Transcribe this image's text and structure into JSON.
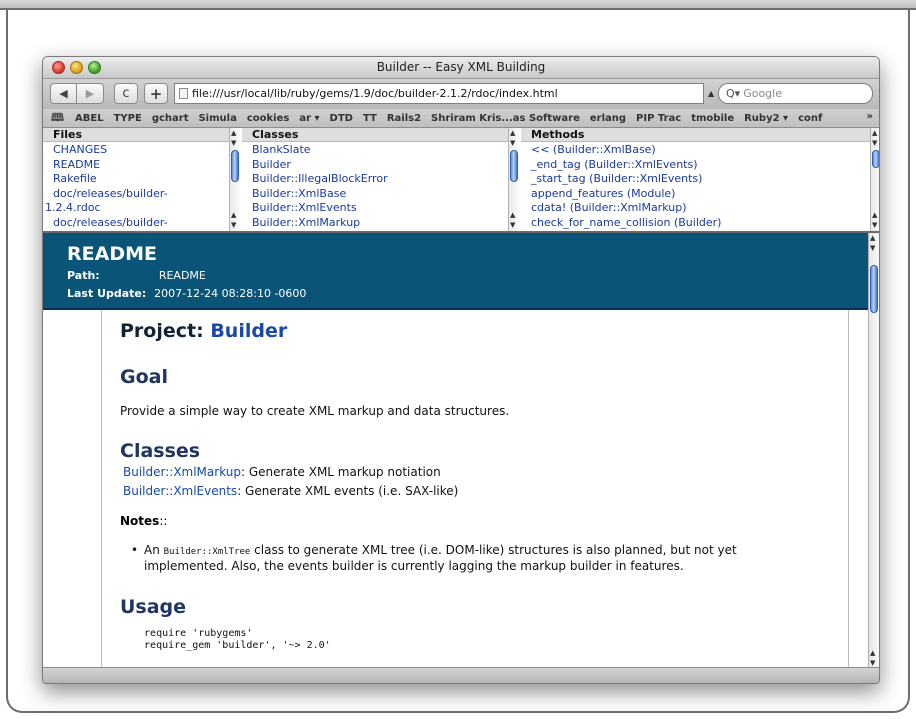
{
  "window": {
    "title": "Builder -- Easy XML Building"
  },
  "toolbar": {
    "back_icon": "◀",
    "forward_icon": "▶",
    "reload_icon": "c",
    "add_icon": "+",
    "url": "file:///usr/local/lib/ruby/gems/1.9/doc/builder-2.1.2/rdoc/index.html",
    "search_placeholder": "Google",
    "search_icon": "Q▾"
  },
  "bookmarks": {
    "book_icon": "🕮",
    "items": [
      "ABEL",
      "TYPE",
      "gchart",
      "Simula",
      "cookies",
      "ar ▾",
      "DTD",
      "TT",
      "Rails2",
      "Shriram Kris...as Software",
      "erlang",
      "PIP Trac",
      "tmobile",
      "Ruby2 ▾",
      "conf"
    ],
    "more": "»"
  },
  "frames": {
    "files": {
      "header": "Files",
      "items": [
        "CHANGES",
        "README",
        "Rakefile",
        "doc/releases/builder-",
        "1.2.4.rdoc",
        "doc/releases/builder-"
      ]
    },
    "classes": {
      "header": "Classes",
      "items": [
        "BlankSlate",
        "Builder",
        "Builder::IllegalBlockError",
        "Builder::XmlBase",
        "Builder::XmlEvents",
        "Builder::XmlMarkup"
      ]
    },
    "methods": {
      "header": "Methods",
      "items": [
        "<< (Builder::XmlBase)",
        "_end_tag (Builder::XmlEvents)",
        "_start_tag (Builder::XmlEvents)",
        "append_features (Module)",
        "cdata! (Builder::XmlMarkup)",
        "check_for_name_collision (Builder)"
      ]
    }
  },
  "banner": {
    "title": "README",
    "path_label": "Path:",
    "path_value": "README",
    "update_label": "Last Update:",
    "update_value": "2007-12-24 08:28:10 -0600"
  },
  "doc": {
    "project_prefix": "Project: ",
    "project_name": "Builder",
    "goal_heading": "Goal",
    "goal_text": "Provide a simple way to create XML markup and data structures.",
    "classes_heading": "Classes",
    "class1_link": "Builder::XmlMarkup",
    "class1_desc": ": Generate XML markup notiation",
    "class2_link": "Builder::XmlEvents",
    "class2_desc": ":  Generate XML events (i.e. SAX-like)",
    "notes_label": "Notes",
    "notes_suffix": "::",
    "bullet_prefix": "An ",
    "bullet_code": "Builder::XmlTree",
    "bullet_text": " class to generate XML tree (i.e. DOM-like) structures is also planned, but not yet implemented. Also, the events builder is currently lagging the markup builder in features.",
    "usage_heading": "Usage",
    "code": "  require 'rubygems'\n  require_gem 'builder', '~> 2.0'"
  }
}
